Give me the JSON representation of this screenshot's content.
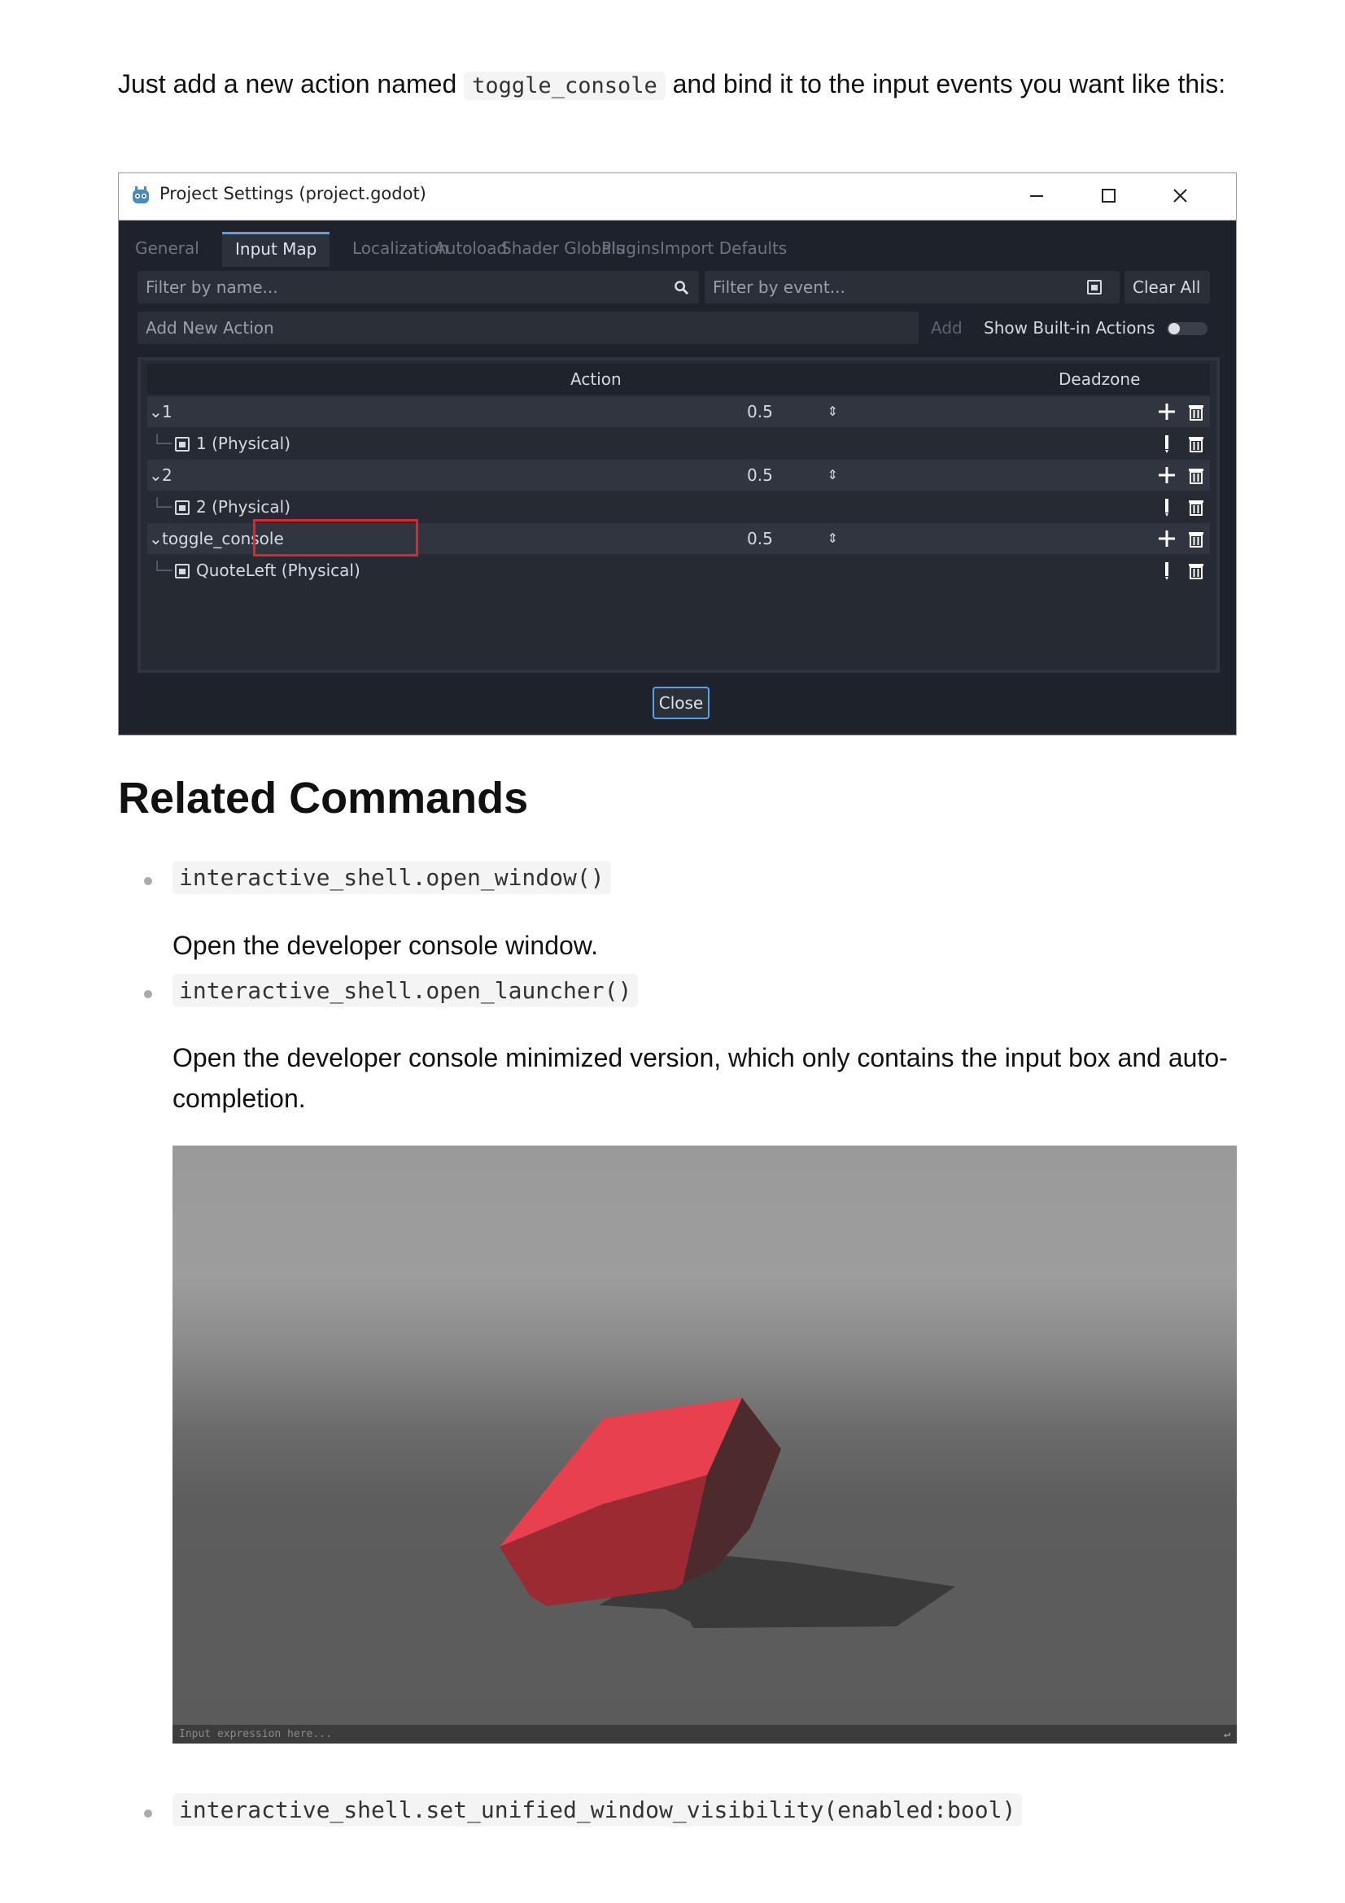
{
  "intro": {
    "before": "Just add a new action named",
    "code": "toggle_console",
    "after": "and bind it to the input events you want like this:"
  },
  "settings_window": {
    "title": "Project Settings (project.godot)",
    "tabs": [
      "General",
      "Input Map",
      "Localization",
      "Autoload",
      "Shader Globals",
      "Plugins",
      "Import Defaults"
    ],
    "active_tab": "Input Map",
    "filter_name_placeholder": "Filter by name...",
    "filter_event_placeholder": "Filter by event...",
    "clear_all": "Clear All",
    "add_new_action_placeholder": "Add New Action",
    "add_label": "Add",
    "show_builtin_label": "Show Built-in Actions",
    "columns": {
      "action": "Action",
      "deadzone": "Deadzone"
    },
    "actions": [
      {
        "name": "1",
        "deadzone": "0.5",
        "event": "1 (Physical)"
      },
      {
        "name": "2",
        "deadzone": "0.5",
        "event": "2 (Physical)"
      },
      {
        "name": "toggle_console",
        "deadzone": "0.5",
        "event": "QuoteLeft (Physical)"
      }
    ],
    "close_label": "Close"
  },
  "section_title": "Related Commands",
  "commands": [
    {
      "code": "interactive_shell.open_window()",
      "description": "Open the developer console window."
    },
    {
      "code": "interactive_shell.open_launcher()",
      "description": "Open the developer console minimized version, which only contains the input box and auto-completion."
    },
    {
      "code": "interactive_shell.set_unified_window_visibility(enabled:bool)",
      "description": ""
    }
  ],
  "viewport": {
    "input_placeholder": "Input expression here..."
  },
  "colors": {
    "accent": "#5aa0e6",
    "highlight": "#e0262b",
    "cube_top": "#e8404f",
    "cube_front": "#9c2a32",
    "cube_side": "#4d2a2c"
  }
}
